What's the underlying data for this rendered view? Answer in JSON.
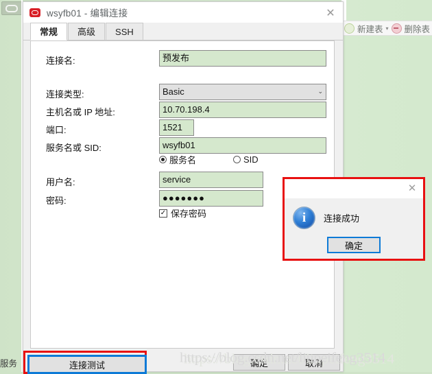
{
  "background": {
    "toolbar": {
      "new_table_label": "新建表",
      "caret": "▾",
      "delete_table_label": "删除表"
    },
    "bottom_left_text": "服务",
    "top_left_icon": "window-thumbnail-icon"
  },
  "dialog": {
    "title": "wsyfb01 - 编辑连接",
    "close_label": "✕",
    "app_icon": "navicat-icon",
    "tabs": [
      {
        "label": "常规",
        "active": true
      },
      {
        "label": "高级",
        "active": false
      },
      {
        "label": "SSH",
        "active": false
      }
    ],
    "fields": {
      "conn_name_label": "连接名:",
      "conn_name_value": "预发布",
      "conn_type_label": "连接类型:",
      "conn_type_value": "Basic",
      "conn_type_arrow": "⌄",
      "host_label": "主机名或 IP 地址:",
      "host_value": "10.70.198.4",
      "port_label": "端口:",
      "port_value": "1521",
      "service_label": "服务名或 SID:",
      "service_value": "wsyfb01",
      "radio_service_label": "服务名",
      "radio_sid_label": "SID",
      "radio_selected": "服务名",
      "username_label": "用户名:",
      "username_value": "service",
      "password_label": "密码:",
      "password_value": "●●●●●●●",
      "save_password_label": "保存密码",
      "save_password_checked": true,
      "checkbox_glyph": "✓"
    },
    "buttons": {
      "test_connection": "连接测试",
      "ok": "确定",
      "cancel": "取消"
    }
  },
  "message_box": {
    "close_label": "✕",
    "icon": "info-icon",
    "icon_glyph": "i",
    "text": "连接成功",
    "ok_label": "确定"
  },
  "watermark": {
    "line": "https://blog.csdn.net/liupeifeng3514"
  },
  "colors": {
    "desktop_green": "#cfe3c8",
    "field_green": "#d5e8cd",
    "annotation_red": "#e81010",
    "focus_blue": "#0d7ad6",
    "info_blue": "#2f7fd6",
    "navicat_red": "#d81f26"
  }
}
